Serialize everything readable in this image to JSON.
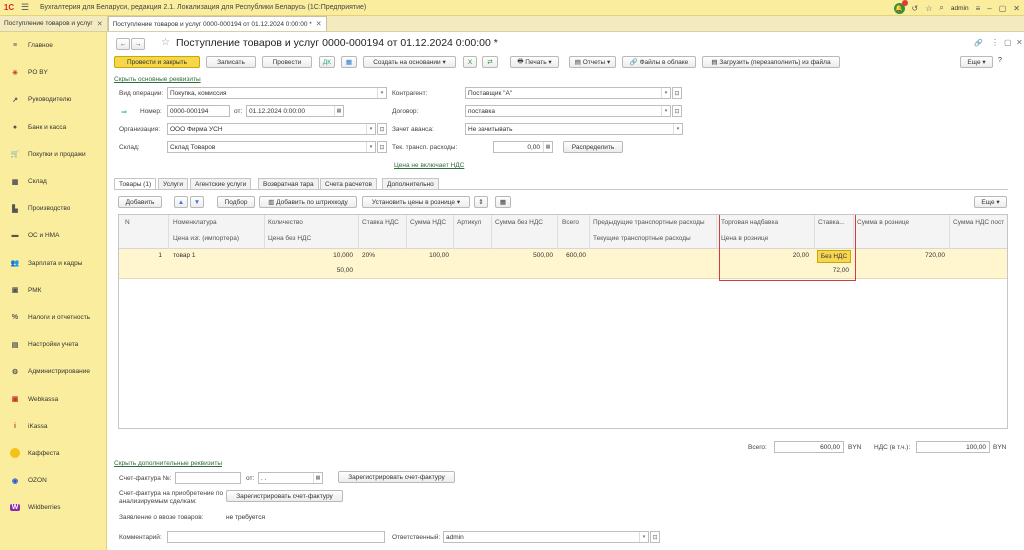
{
  "app": {
    "title": "Бухгалтерия для Беларуси, редакция 2.1. Локализация для Республики Беларусь   (1С:Предприятие)",
    "user": "admin",
    "notification_count": "4"
  },
  "window_tabs": [
    {
      "label": "Поступление товаров и услуг"
    },
    {
      "label": "Поступление товаров и услуг 0000-000194 от 01.12.2024 0:00:00 *"
    }
  ],
  "sidebar": {
    "items": [
      {
        "label": "Главное",
        "icon": "menu-icon"
      },
      {
        "label": "PO BY",
        "icon": "asterisk-icon"
      },
      {
        "label": "Руководителю",
        "icon": "trend-icon"
      },
      {
        "label": "Банк и касса",
        "icon": "bank-icon"
      },
      {
        "label": "Покупки и продажи",
        "icon": "cart-icon"
      },
      {
        "label": "Склад",
        "icon": "warehouse-icon"
      },
      {
        "label": "Производство",
        "icon": "factory-icon"
      },
      {
        "label": "ОС и НМА",
        "icon": "truck-icon"
      },
      {
        "label": "Зарплата и кадры",
        "icon": "people-icon"
      },
      {
        "label": "РМК",
        "icon": "register-icon"
      },
      {
        "label": "Налоги и отчетность",
        "icon": "tax-icon"
      },
      {
        "label": "Настройки учета",
        "icon": "book-icon"
      },
      {
        "label": "Администрирование",
        "icon": "gear-icon"
      },
      {
        "label": "Webkassa",
        "icon": "webkassa-icon"
      },
      {
        "label": "iKassa",
        "icon": "ikassa-icon"
      },
      {
        "label": "Каффеста",
        "icon": "kaffesta-icon"
      },
      {
        "label": "OZON",
        "icon": "ozon-icon"
      },
      {
        "label": "Wildberries",
        "icon": "wildberries-icon"
      }
    ]
  },
  "form": {
    "title": "Поступление товаров и услуг 0000-000194 от 01.12.2024 0:00:00 *",
    "toolbar": {
      "post_close": "Провести и закрыть",
      "save": "Записать",
      "post": "Провести",
      "create_based": "Создать на основании",
      "print": "Печать",
      "reports": "Отчеты",
      "cloud_files": "Файлы в облаке",
      "load_file": "Загрузить (перезаполнить) из файла",
      "more": "Еще"
    },
    "hide_main": "Скрыть основные реквизиты",
    "fields": {
      "op_type_label": "Вид операции:",
      "op_type": "Покупка, комиссия",
      "number_label": "Номер:",
      "number": "0000-000194",
      "date_label": "от:",
      "date": "01.12.2024  0:00:00",
      "org_label": "Организация:",
      "org": "ООО Фирма УСН",
      "warehouse_label": "Склад:",
      "warehouse": "Склад Товаров",
      "counterparty_label": "Контрагент:",
      "counterparty": "Поставщик \"А\"",
      "contract_label": "Договор:",
      "contract": "поставка",
      "advance_label": "Зачет аванса:",
      "advance": "Не зачитывать",
      "transport_label": "Тек. трансп. расходы:",
      "transport": "0,00",
      "distribute": "Распределить",
      "vat_link": "Цена не включает НДС"
    },
    "tabs": [
      "Товары (1)",
      "Услуги",
      "Агентские услуги",
      "Возвратная тара",
      "Счета расчетов",
      "Дополнительно"
    ],
    "table_toolbar": {
      "add": "Добавить",
      "pick": "Подбор",
      "barcode": "Добавить по штрихкоду",
      "set_prices": "Установить цены в рознице",
      "more": "Еще"
    },
    "columns": {
      "n": "N",
      "item": "Номенклатура",
      "import_price": "Цена изг. (импортера)",
      "qty": "Количество",
      "price_no_vat": "Цена без НДС",
      "vat_rate": "Ставка НДС",
      "vat_sum": "Сумма НДС",
      "article": "Артикул",
      "sum_no_vat": "Сумма без НДС",
      "total": "Всего",
      "prev_transport": "Предыдущие транспортные расходы",
      "cur_transport": "Текущие транспортные расходы",
      "markup": "Торговая надбавка",
      "retail_price": "Цена в рознице",
      "rate": "Ставка...",
      "retail_sum": "Сумма в рознице",
      "retail_vat": "Сумма НДС пост"
    },
    "row": {
      "n": "1",
      "item": "товар 1",
      "qty": "10,000",
      "price_no_vat": "50,00",
      "vat_rate": "20%",
      "vat_sum": "100,00",
      "sum_no_vat": "500,00",
      "total": "600,00",
      "markup": "20,00",
      "retail_price": "72,00",
      "rate": "Без НДС",
      "retail_sum": "720,00"
    },
    "totals": {
      "total_label": "Всего:",
      "total": "600,00",
      "currency": "BYN",
      "vat_label": "НДС (в т.ч.):",
      "vat": "100,00",
      "currency2": "BYN"
    },
    "footer": {
      "show_extra": "Скрыть дополнительные реквизиты",
      "invoice_label": "Счет-фактура №:",
      "invoice_from": "от:",
      "invoice_date": " .  .",
      "register_invoice": "Зарегистрировать счет-фактуру",
      "invoice_analyzed_label": "Счет-фактура на приобретение по анализируемым сделкам:",
      "register_invoice2": "Зарегистрировать счет-фактуру",
      "import_label": "Заявление о ввозе товаров:",
      "import_value": "не требуется",
      "comment_label": "Комментарий:",
      "comment": "",
      "responsible_label": "Ответственный:",
      "responsible": "admin"
    }
  }
}
